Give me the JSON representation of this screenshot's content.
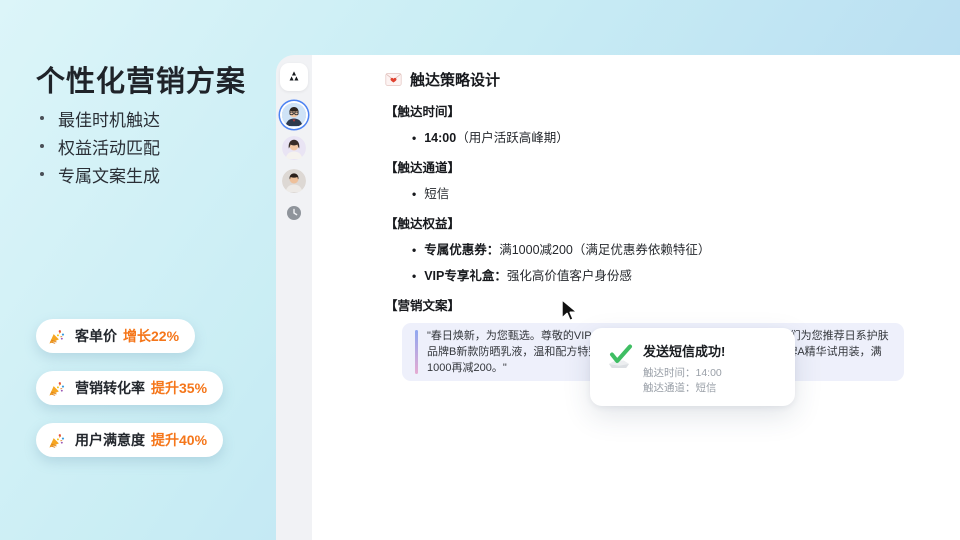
{
  "left_panel": {
    "title": "个性化营销方案",
    "bullets": [
      "最佳时机触达",
      "权益活动匹配",
      "专属文案生成"
    ],
    "badges": [
      {
        "icon": "party-popper",
        "label": "客单价",
        "value": "增长22%"
      },
      {
        "icon": "party-popper",
        "label": "营销转化率",
        "value": "提升35%"
      },
      {
        "icon": "party-popper",
        "label": "用户满意度",
        "value": "提升40%"
      }
    ],
    "accent_color": "#f5761a"
  },
  "rail": {
    "logo_icon": "app-logo",
    "avatar_icons": [
      "agent-avatar-male-glasses",
      "agent-avatar-female",
      "agent-avatar-male"
    ],
    "selected_avatar_index": 0,
    "history_icon": "clock"
  },
  "document": {
    "title_icon": "love-letter",
    "title": "触达策略设计",
    "sections": {
      "time": {
        "heading": "【触达时间】",
        "item_bold": "14:00",
        "item_text": "（用户活跃高峰期）"
      },
      "channel": {
        "heading": "【触达通道】",
        "item_bold": "",
        "item_text": "短信"
      },
      "benefit": {
        "heading": "【触达权益】",
        "item1_bold": "专属优惠券：",
        "item1_text": "满1000减200（满足优惠券依赖特征）",
        "item2_bold": "VIP专享礼盒：",
        "item2_text": "强化高价值客户身份感"
      },
      "copy": {
        "heading": "【营销文案】",
        "quote": "\"春日焕新，为您甄选。尊敬的VIP会员，根据您对抗老保湿产品的喜爱，我们为您推荐日系护肤品牌B新款防晒乳液，温和配方特别适合敏感肌。现在购买即赠高端护肤品牌A精华试用装，满1000再减200。\""
      }
    }
  },
  "toast": {
    "icon": "check-success",
    "title": "发送短信成功!",
    "line1": "触达时间：14:00",
    "line2": "触达通道：短信",
    "success_color": "#3fbe63"
  }
}
